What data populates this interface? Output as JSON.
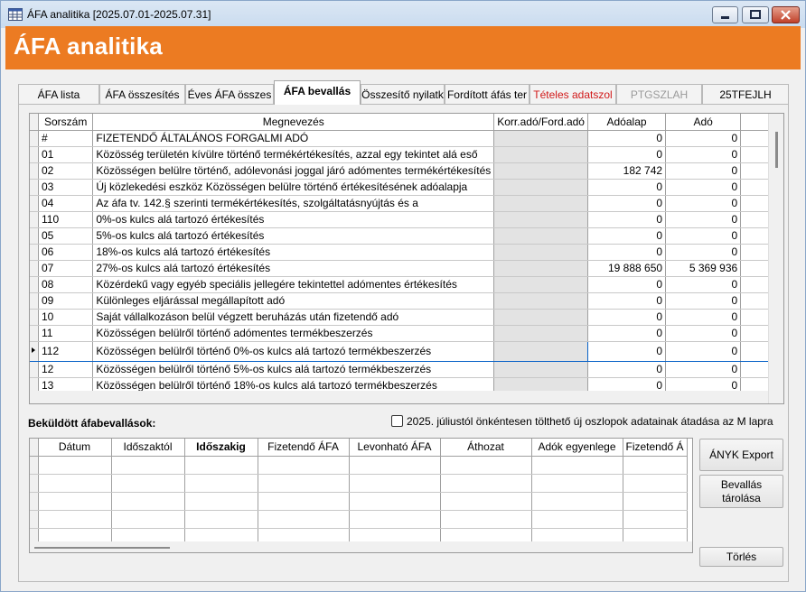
{
  "window": {
    "title": "ÁFA analitika [2025.07.01-2025.07.31]"
  },
  "header": {
    "title": "ÁFA analitika"
  },
  "tabs": [
    {
      "label": "ÁFA lista"
    },
    {
      "label": "ÁFA összesítés"
    },
    {
      "label": "Éves ÁFA összes"
    },
    {
      "label": "ÁFA bevallás"
    },
    {
      "label": "Összesítő nyilatk"
    },
    {
      "label": "Fordított áfás ter"
    },
    {
      "label": "Tételes adatszol"
    },
    {
      "label": "PTGSZLAH"
    },
    {
      "label": "25TFEJLH"
    }
  ],
  "colors": {
    "accent": "#ec7b22",
    "red_tab": "#d11919",
    "selection": "#0a63c8"
  },
  "main_grid": {
    "columns": [
      "Sorszám",
      "Megnevezés",
      "Korr.adó/Ford.adó",
      "Adóalap",
      "Adó"
    ],
    "rows": [
      {
        "code": "#",
        "name": "FIZETENDŐ ÁLTALÁNOS FORGALMI ADÓ",
        "korr": "",
        "base": "0",
        "tax": "0"
      },
      {
        "code": "01",
        "name": "Közösség területén kívülre történő termékértékesítés, azzal egy tekintet alá eső",
        "korr": "",
        "base": "0",
        "tax": "0"
      },
      {
        "code": "02",
        "name": "Közösségen belülre történő, adólevonási joggal járó adómentes termékértékesítés",
        "korr": "",
        "base": "182 742",
        "tax": "0"
      },
      {
        "code": "03",
        "name": "Új közlekedési eszköz Közösségen belülre történő értékesítésének adóalapja",
        "korr": "",
        "base": "0",
        "tax": "0"
      },
      {
        "code": "04",
        "name": "Az áfa tv. 142.§ szerinti termékértékesítés, szolgáltatásnyújtás és a",
        "korr": "",
        "base": "0",
        "tax": "0"
      },
      {
        "code": "110",
        "name": "0%-os kulcs alá tartozó értékesítés",
        "korr": "",
        "base": "0",
        "tax": "0"
      },
      {
        "code": "05",
        "name": "5%-os kulcs alá tartozó értékesítés",
        "korr": "",
        "base": "0",
        "tax": "0"
      },
      {
        "code": "06",
        "name": "18%-os kulcs alá tartozó értékesítés",
        "korr": "",
        "base": "0",
        "tax": "0"
      },
      {
        "code": "07",
        "name": "27%-os kulcs alá tartozó értékesítés",
        "korr": "",
        "base": "19 888 650",
        "tax": "5 369 936"
      },
      {
        "code": "08",
        "name": "Közérdekű vagy egyéb speciális jellegére tekintettel adómentes értékesítés",
        "korr": "",
        "base": "0",
        "tax": "0"
      },
      {
        "code": "09",
        "name": "Különleges eljárással megállapított adó",
        "korr": "",
        "base": "0",
        "tax": "0"
      },
      {
        "code": "10",
        "name": "Saját vállalkozáson belül végzett beruházás után fizetendő adó",
        "korr": "",
        "base": "0",
        "tax": "0"
      },
      {
        "code": "11",
        "name": "Közösségen belülről történő adómentes termékbeszerzés",
        "korr": "",
        "base": "0",
        "tax": "0"
      },
      {
        "code": "112",
        "name": "Közösségen belülről történő 0%-os kulcs alá tartozó termékbeszerzés",
        "korr": "",
        "base": "0",
        "tax": "0",
        "selected": true
      },
      {
        "code": "12",
        "name": "Közösségen belülről történő 5%-os kulcs alá tartozó termékbeszerzés",
        "korr": "",
        "base": "0",
        "tax": "0"
      },
      {
        "code": "13",
        "name": "Közösségen belülről történő 18%-os kulcs alá tartozó termékbeszerzés",
        "korr": "",
        "base": "0",
        "tax": "0"
      }
    ]
  },
  "submitted": {
    "label": "Beküldött áfabevallások:",
    "checkbox_label": "2025. júliustól önkéntesen tölthető új oszlopok adatainak átadása az M lapra",
    "checked": false,
    "columns": [
      "Dátum",
      "Időszaktól",
      "Időszakig",
      "Fizetendő ÁFA",
      "Levonható ÁFA",
      "Áthozat",
      "Adók egyenlege",
      "Fizetendő Á"
    ]
  },
  "buttons": {
    "export": "ÁNYK Export",
    "store": "Bevallás tárolása",
    "delete": "Törlés"
  }
}
